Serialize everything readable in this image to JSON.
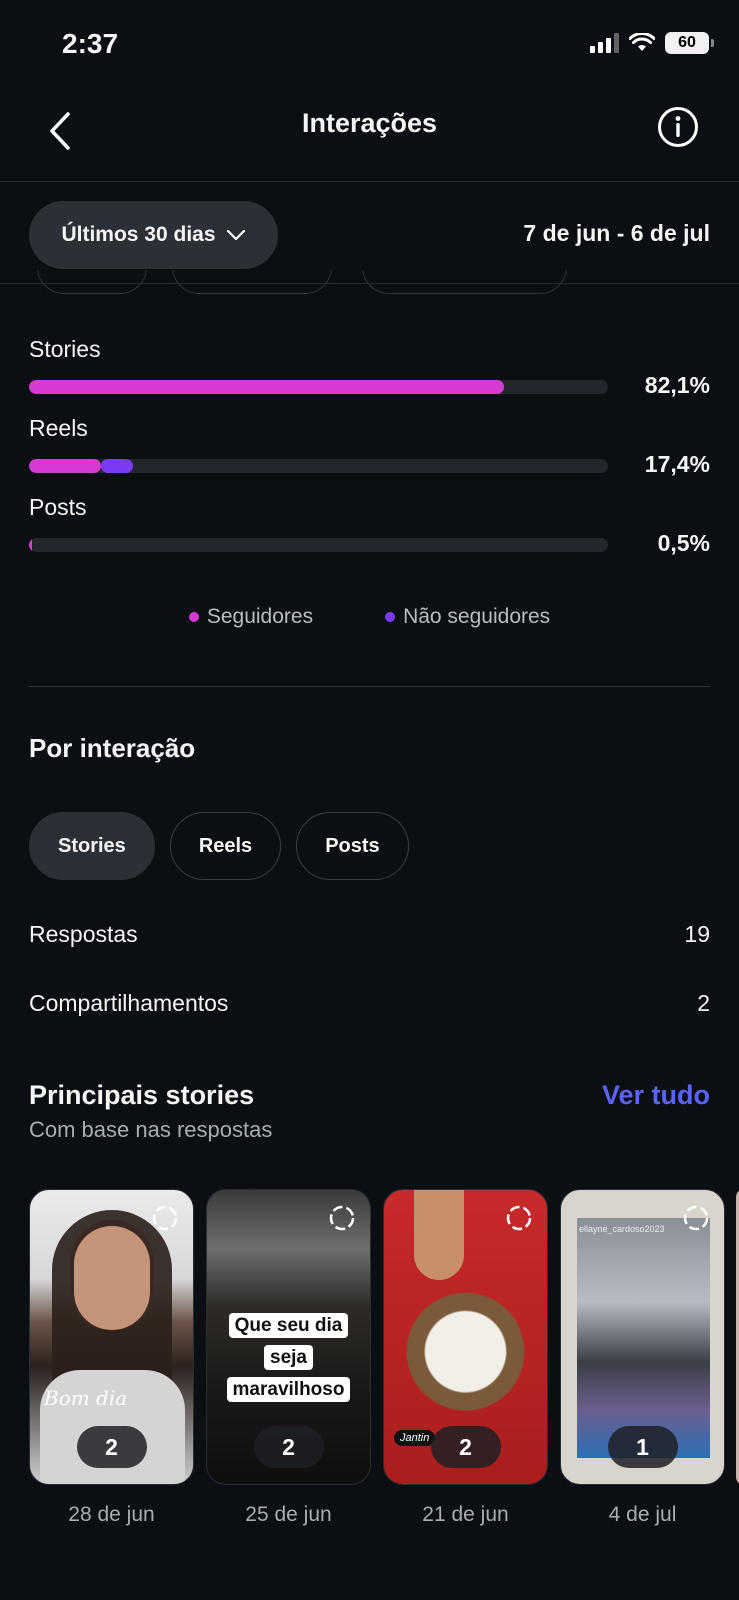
{
  "status": {
    "time": "2:37",
    "battery": "60"
  },
  "nav": {
    "title": "Interações"
  },
  "filter": {
    "period": "Últimos 30 dias",
    "range": "7 de jun - 6 de jul"
  },
  "breakdown": [
    {
      "label": "Stories",
      "percent_text": "82,1%",
      "followers": 82.1,
      "non_followers": 0
    },
    {
      "label": "Reels",
      "percent_text": "17,4%",
      "followers": 12.4,
      "non_followers": 5.6
    },
    {
      "label": "Posts",
      "percent_text": "0,5%",
      "followers": 0.5,
      "non_followers": 0
    }
  ],
  "legend": {
    "followers": "Seguidores",
    "non_followers": "Não seguidores"
  },
  "colors": {
    "followers": "#d63ad1",
    "non_followers": "#7a3cf2",
    "accent": "#5b63f6"
  },
  "by_interaction": {
    "title": "Por interação",
    "tabs": [
      "Stories",
      "Reels",
      "Posts"
    ],
    "metrics": [
      {
        "label": "Respostas",
        "value": "19"
      },
      {
        "label": "Compartilhamentos",
        "value": "2"
      }
    ]
  },
  "top_stories": {
    "title": "Principais stories",
    "subtitle": "Com base nas respostas",
    "see_all": "Ver tudo",
    "items": [
      {
        "date": "28 de jun",
        "count": "2",
        "overlay": "Bom dia"
      },
      {
        "date": "25 de jun",
        "count": "2",
        "overlay": "Que seu dia seja maravilhoso"
      },
      {
        "date": "21 de jun",
        "count": "2",
        "overlay": "Jantin"
      },
      {
        "date": "4 de jul",
        "count": "1",
        "overlay": "ellayne_cardoso2023"
      }
    ]
  }
}
